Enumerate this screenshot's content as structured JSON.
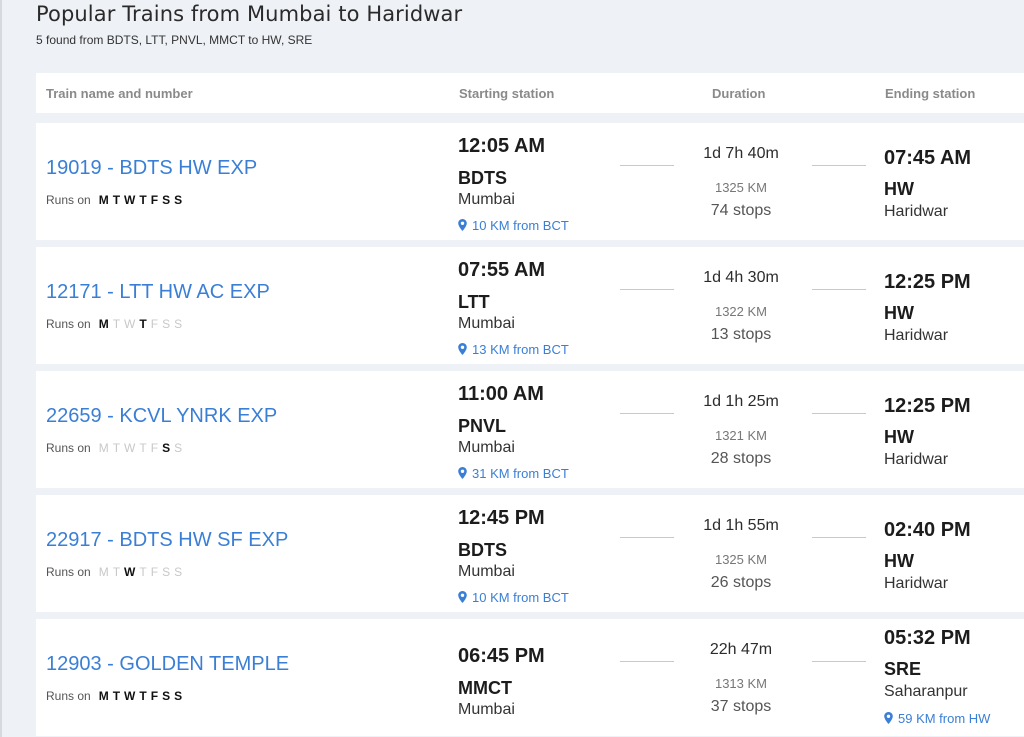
{
  "page": {
    "title": "Popular Trains from Mumbai to Haridwar",
    "subtitle": "5 found from BDTS, LTT, PNVL, MMCT to HW, SRE"
  },
  "table": {
    "headers": {
      "name": "Train name and number",
      "start": "Starting station",
      "duration": "Duration",
      "end": "Ending station"
    },
    "runs_on_label": "Runs on",
    "day_letters": [
      "M",
      "T",
      "W",
      "T",
      "F",
      "S",
      "S"
    ],
    "location_icon": "map-pin-icon",
    "accent_color": "#3a7fd5",
    "rows": [
      {
        "train": "19019 - BDTS HW EXP",
        "days": [
          true,
          true,
          true,
          true,
          true,
          true,
          true
        ],
        "dep_time": "12:05 AM",
        "dep_code": "BDTS",
        "dep_city": "Mumbai",
        "dep_loc": "10 KM from BCT",
        "duration": "1d 7h 40m",
        "distance": "1325 KM",
        "stops": "74 stops",
        "arr_time": "07:45 AM",
        "arr_code": "HW",
        "arr_city": "Haridwar",
        "arr_loc": null
      },
      {
        "train": "12171 - LTT HW AC EXP",
        "days": [
          true,
          false,
          false,
          true,
          false,
          false,
          false
        ],
        "dep_time": "07:55 AM",
        "dep_code": "LTT",
        "dep_city": "Mumbai",
        "dep_loc": "13 KM from BCT",
        "duration": "1d 4h 30m",
        "distance": "1322 KM",
        "stops": "13 stops",
        "arr_time": "12:25 PM",
        "arr_code": "HW",
        "arr_city": "Haridwar",
        "arr_loc": null
      },
      {
        "train": "22659 - KCVL YNRK EXP",
        "days": [
          false,
          false,
          false,
          false,
          false,
          true,
          false
        ],
        "dep_time": "11:00 AM",
        "dep_code": "PNVL",
        "dep_city": "Mumbai",
        "dep_loc": "31 KM from BCT",
        "duration": "1d 1h 25m",
        "distance": "1321 KM",
        "stops": "28 stops",
        "arr_time": "12:25 PM",
        "arr_code": "HW",
        "arr_city": "Haridwar",
        "arr_loc": null
      },
      {
        "train": "22917 - BDTS HW SF EXP",
        "days": [
          false,
          false,
          true,
          false,
          false,
          false,
          false
        ],
        "dep_time": "12:45 PM",
        "dep_code": "BDTS",
        "dep_city": "Mumbai",
        "dep_loc": "10 KM from BCT",
        "duration": "1d 1h 55m",
        "distance": "1325 KM",
        "stops": "26 stops",
        "arr_time": "02:40 PM",
        "arr_code": "HW",
        "arr_city": "Haridwar",
        "arr_loc": null
      },
      {
        "train": "12903 - GOLDEN TEMPLE",
        "days": [
          true,
          true,
          true,
          true,
          true,
          true,
          true
        ],
        "dep_time": "06:45 PM",
        "dep_code": "MMCT",
        "dep_city": "Mumbai",
        "dep_loc": null,
        "duration": "22h 47m",
        "distance": "1313 KM",
        "stops": "37 stops",
        "arr_time": "05:32 PM",
        "arr_code": "SRE",
        "arr_city": "Saharanpur",
        "arr_loc": "59 KM from HW"
      }
    ]
  }
}
